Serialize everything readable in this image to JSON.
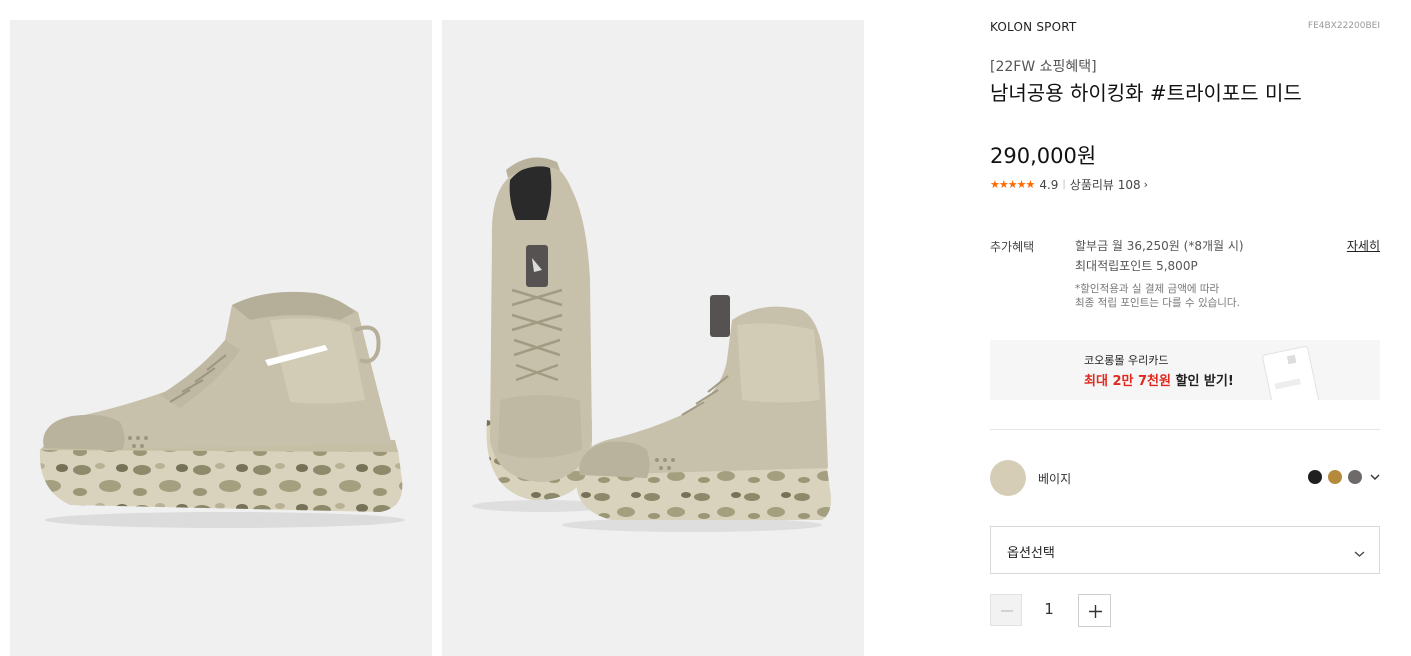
{
  "product": {
    "brand": "KOLON SPORT",
    "code": "FE4BX22200BEI",
    "promo_tag": "[22FW 쇼핑혜택]",
    "title": "남녀공용 하이킹화 #트라이포드 미드",
    "price": "290,000원",
    "rating": {
      "stars_glyph": "★★★★★",
      "score": "4.9",
      "review_label": "상품리뷰 108"
    }
  },
  "benefits": {
    "label": "추가혜택",
    "detail_link": "자세히",
    "installment": "할부금 월 36,250원 (*8개월 시)",
    "points": "최대적립포인트 5,800P",
    "note_line1": "*할인적용과 실 결제 금액에 따라",
    "note_line2": "최종 적립 포인트는 다를 수 있습니다."
  },
  "card_banner": {
    "line1": "코오롱몰 우리카드",
    "highlight": "최대 2만 7천원",
    "rest": " 할인 받기!"
  },
  "color": {
    "selected_name": "베이지",
    "selected_hex": "#d5cdb6",
    "options": [
      "#1f1f1f",
      "#b58a3a",
      "#6e6a6a"
    ]
  },
  "option_select": {
    "placeholder": "옵션선택"
  },
  "quantity": {
    "value": "1"
  },
  "colors": {
    "accent_star": "#ff6a00",
    "card_red": "#e0281e"
  }
}
